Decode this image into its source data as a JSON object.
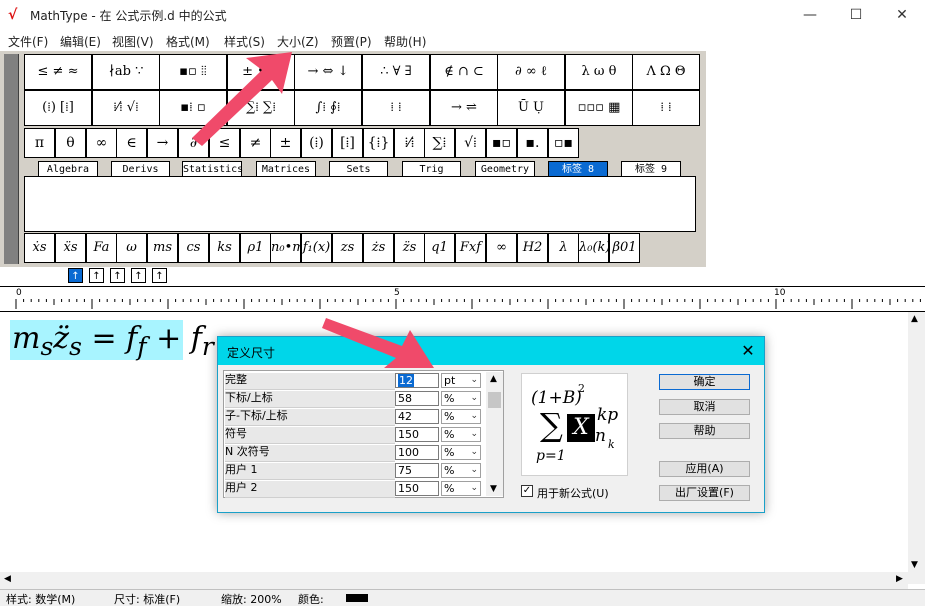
{
  "window": {
    "title": "MathType - 在 公式示例.d 中的公式",
    "logo_glyph": "√",
    "minimize": "—",
    "maximize": "☐",
    "close": "✕"
  },
  "menu": [
    "文件(F)",
    "编辑(E)",
    "视图(V)",
    "格式(M)",
    "样式(S)",
    "大小(Z)",
    "预置(P)",
    "帮助(H)"
  ],
  "palette_row1": [
    "≤ ≠ ≈",
    "∤ab ∵",
    "▪▫ ⦙⦙",
    "± • ⊗",
    "→ ⇔ ↓",
    "∴ ∀ ∃",
    "∉ ∩ ⊂",
    "∂ ∞ ℓ",
    "λ ω θ",
    "Λ Ω Θ"
  ],
  "palette_row2": [
    "(⁞) [⁞]",
    "⁞⁄⁞ √⁞",
    "▪⁞ ▫",
    "∑⁞ ∑⁞",
    "∫⁞ ∮⁞",
    "⁞ ⁞",
    "→ ⇌",
    "Ū Ụ",
    "▫▫▫ ▦",
    "⁞ ⁞"
  ],
  "symbols_row": [
    "π",
    "θ",
    "∞",
    "∈",
    "→",
    "∂",
    "≤",
    "≠",
    "±",
    "(⁞)",
    "[⁞]",
    "{⁞}",
    "⁞⁄⁞",
    "∑⁞",
    "√⁞",
    "▪▫",
    "▪.",
    "▫▪"
  ],
  "tabs": [
    "Algebra",
    "Derivs",
    "Statistics",
    "Matrices",
    "Sets",
    "Trig",
    "Geometry",
    "标签 8",
    "标签 9"
  ],
  "active_tab": "标签 8",
  "template_row": [
    "ẋs",
    "ẍs",
    "Fa",
    "ω",
    "ms",
    "cs",
    "ks",
    "ρ1",
    "n₀•m",
    "f₁(x)",
    "zs",
    "żs",
    "z̈s",
    "q1",
    "Fxf",
    "∞",
    "H2",
    "λ",
    "λ₀(k)",
    "β01"
  ],
  "size_buttons": [
    "↑",
    "↑",
    "↑",
    "↑",
    "↑"
  ],
  "ruler": {
    "marks": [
      "0",
      "5",
      "10"
    ]
  },
  "equation": "m<sub>s</sub>z̈<sub>s</sub> = f<sub>f</sub> + f<sub>r</sub>",
  "status": {
    "style": "样式: 数学(M)",
    "size": "尺寸: 标准(F)",
    "zoom": "缩放: 200%",
    "color": "颜色:"
  },
  "dialog": {
    "title": "定义尺寸",
    "rows": [
      {
        "label": "完整",
        "value": "12",
        "unit": "pt"
      },
      {
        "label": "下标/上标",
        "value": "58",
        "unit": "%"
      },
      {
        "label": "子-下标/上标",
        "value": "42",
        "unit": "%"
      },
      {
        "label": "符号",
        "value": "150",
        "unit": "%"
      },
      {
        "label": "N 次符号",
        "value": "100",
        "unit": "%"
      },
      {
        "label": "用户 1",
        "value": "75",
        "unit": "%"
      },
      {
        "label": "用户 2",
        "value": "150",
        "unit": "%"
      }
    ],
    "preview": {
      "top": "(1+B)",
      "top_exp": "2",
      "sum": "∑",
      "var": "X",
      "sup": "kp",
      "sub": "n",
      "subsub": "k",
      "lower": "p=1"
    },
    "checkbox_label": "用于新公式(U)",
    "checkbox_checked": true,
    "buttons": {
      "ok": "确定",
      "cancel": "取消",
      "help": "帮助",
      "apply": "应用(A)",
      "factory": "出厂设置(F)"
    }
  },
  "colors": {
    "accent": "#0a6ad2",
    "dialog_title": "#00d6e9",
    "equation_highlight": "#a8f4ff",
    "arrow": "#f04a6a"
  }
}
